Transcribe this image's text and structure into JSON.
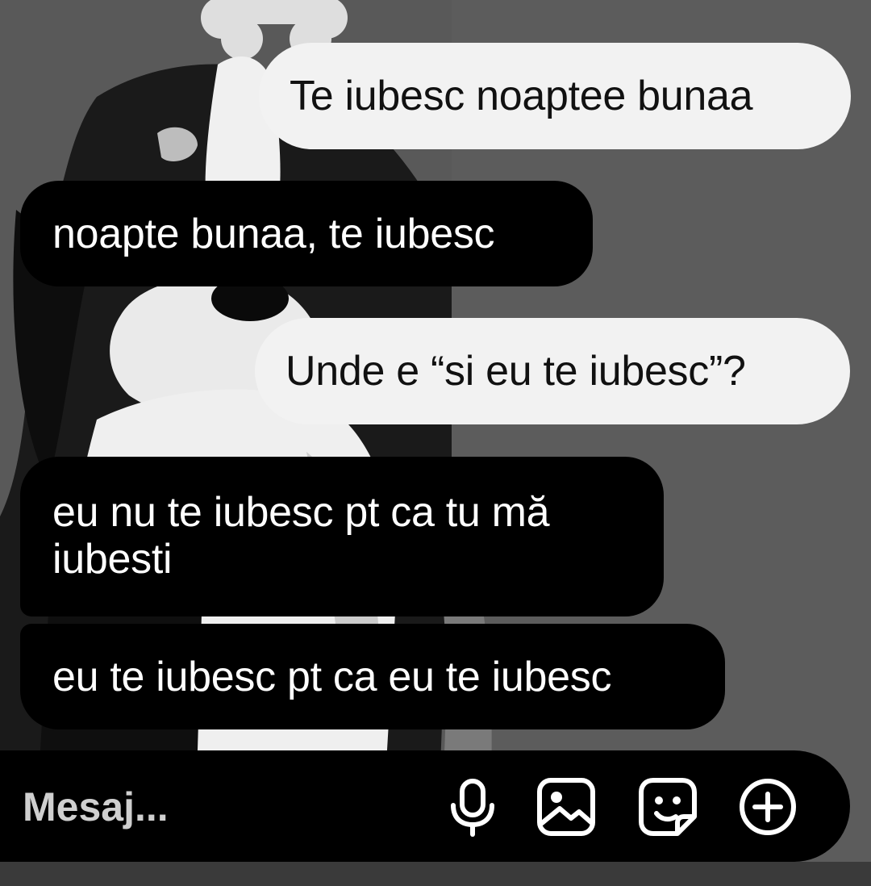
{
  "conversation": {
    "messages": [
      {
        "direction": "outgoing",
        "text": "Te iubesc noaptee bunaa"
      },
      {
        "direction": "incoming",
        "text": "noapte bunaa, te iubesc"
      },
      {
        "direction": "outgoing",
        "text": "Unde e “si eu te iubesc”?"
      },
      {
        "direction": "incoming",
        "text": "eu nu te iubesc pt ca tu mă iubesti"
      },
      {
        "direction": "incoming",
        "text": "eu te iubesc pt ca eu te iubesc"
      }
    ]
  },
  "composer": {
    "placeholder": "Mesaj...",
    "icons": [
      "microphone-icon",
      "gallery-icon",
      "sticker-icon",
      "plus-icon"
    ]
  },
  "colors": {
    "outgoing_bubble": "#f2f2f2",
    "incoming_bubble": "#000000",
    "wallpaper": "#5a5a5a"
  }
}
